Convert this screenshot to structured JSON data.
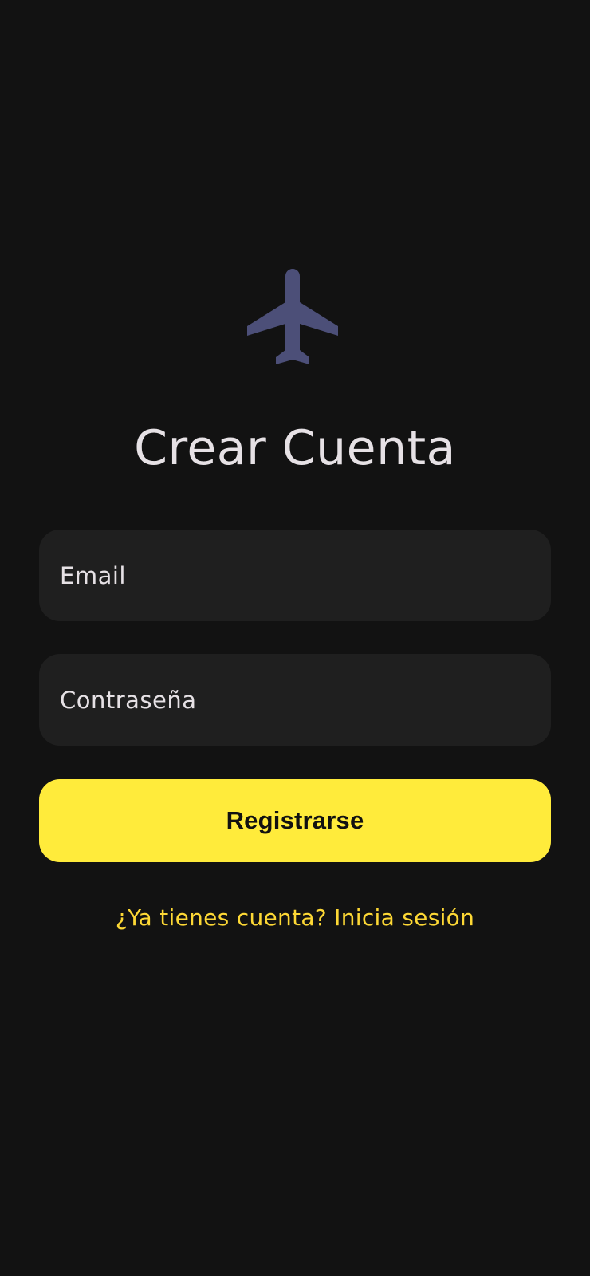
{
  "logo": {
    "icon": "airplane-icon",
    "color": "#4C4F78"
  },
  "title": "Crear Cuenta",
  "form": {
    "email_placeholder": "Email",
    "password_placeholder": "Contraseña"
  },
  "actions": {
    "register_label": "Registrarse",
    "login_link_label": "¿Ya tienes cuenta? Inicia sesión"
  },
  "colors": {
    "background": "#121212",
    "field_background": "#1F1F1F",
    "accent": "#FFEB3B",
    "link": "#FDD835",
    "text": "#E6E1E5"
  }
}
